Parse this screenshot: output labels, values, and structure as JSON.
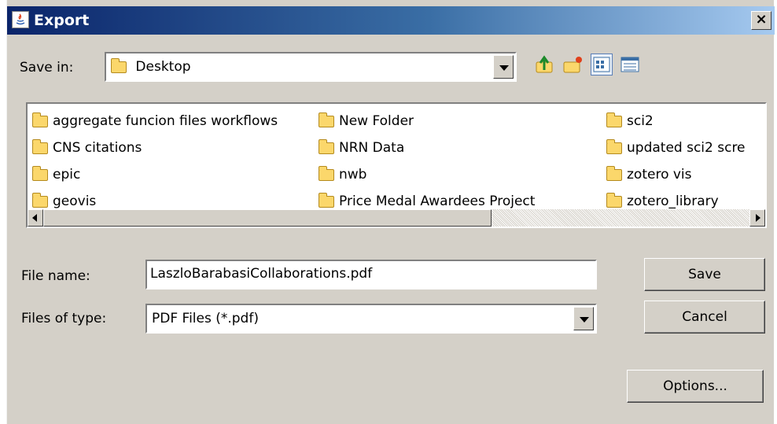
{
  "window": {
    "title": "Export",
    "close_glyph": "×"
  },
  "save_in": {
    "label": "Save in:",
    "value": "Desktop"
  },
  "toolbar": {
    "up_icon": "up-folder-icon",
    "new_folder_icon": "new-folder-icon",
    "list_icon": "list-view-icon",
    "details_icon": "details-view-icon"
  },
  "files": [
    "aggregate funcion files workflows",
    "CNS citations",
    "epic",
    "geovis",
    "New Folder",
    "NRN Data",
    "nwb",
    "Price Medal Awardees Project",
    "sci2",
    "updated sci2 scre",
    "zotero vis",
    "zotero_library"
  ],
  "file_name": {
    "label": "File name:",
    "value": "LaszloBarabasiCollaborations.pdf"
  },
  "file_type": {
    "label": "Files of type:",
    "value": "PDF Files (*.pdf)"
  },
  "buttons": {
    "save": "Save",
    "cancel": "Cancel",
    "options": "Options..."
  }
}
